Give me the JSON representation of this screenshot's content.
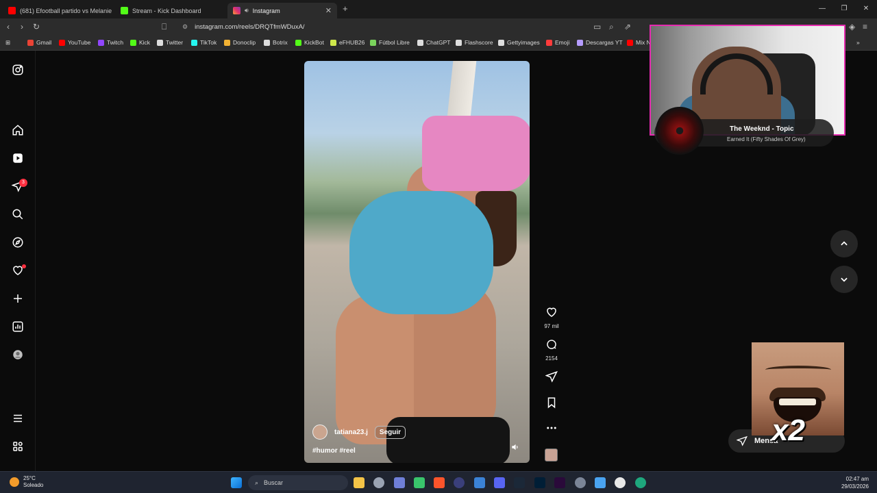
{
  "browser": {
    "tabs": [
      {
        "title": "(681) Efootball partido vs Melanie pa",
        "color": "#ff0000"
      },
      {
        "title": "Stream - Kick Dashboard",
        "color": "#53fc18"
      },
      {
        "title": "Instagram",
        "color": "#e1306c",
        "active": true
      }
    ],
    "url": "instagram.com/reels/DRQTfmWDuxA/",
    "bookmarks": [
      {
        "label": "Gmail",
        "color": "#ea4335"
      },
      {
        "label": "YouTube",
        "color": "#ff0000"
      },
      {
        "label": "Twitch",
        "color": "#9146ff"
      },
      {
        "label": "Kick",
        "color": "#53fc18"
      },
      {
        "label": "Twitter",
        "color": "#dddddd"
      },
      {
        "label": "TikTok",
        "color": "#25f4ee"
      },
      {
        "label": "Donoclip",
        "color": "#f2b233"
      },
      {
        "label": "Botrix",
        "color": "#dddddd"
      },
      {
        "label": "KickBot",
        "color": "#53fc18"
      },
      {
        "label": "eFHUB26",
        "color": "#cfe84b"
      },
      {
        "label": "Fútbol Libre",
        "color": "#7ad35c"
      },
      {
        "label": "ChatGPT",
        "color": "#dddddd"
      },
      {
        "label": "Flashscore",
        "color": "#dddddd"
      },
      {
        "label": "Gettyimages",
        "color": "#dddddd"
      },
      {
        "label": "Emoji",
        "color": "#ff3b3b"
      },
      {
        "label": "Descargas YT",
        "color": "#b59cff"
      },
      {
        "label": "Mix N",
        "color": "#ff0000"
      }
    ]
  },
  "instagram": {
    "nav": [
      {
        "name": "instagram-logo-icon"
      },
      {
        "name": "home-icon"
      },
      {
        "name": "reels-icon"
      },
      {
        "name": "direct-messages-icon",
        "badge": "3"
      },
      {
        "name": "search-icon"
      },
      {
        "name": "explore-icon"
      },
      {
        "name": "notifications-icon"
      },
      {
        "name": "create-icon"
      },
      {
        "name": "dashboard-icon"
      },
      {
        "name": "profile-icon"
      },
      {
        "name": "more-menu-icon"
      },
      {
        "name": "also-from-meta-icon"
      }
    ],
    "reel": {
      "username": "tatiana23.j",
      "follow_label": "Seguir",
      "caption": "#humor #reel",
      "likes": "97 mil",
      "comments": "2154"
    },
    "messages_label": "Mensa"
  },
  "overlay": {
    "music_artist": "The Weeknd - Topic",
    "music_track": "Earned It (Fifty Shades Of Grey)",
    "meme_text": "x2"
  },
  "taskbar": {
    "temperature": "25°C",
    "weather": "Soleado",
    "search_placeholder": "Buscar",
    "time": "02:47 am",
    "date": "29/03/2026"
  }
}
